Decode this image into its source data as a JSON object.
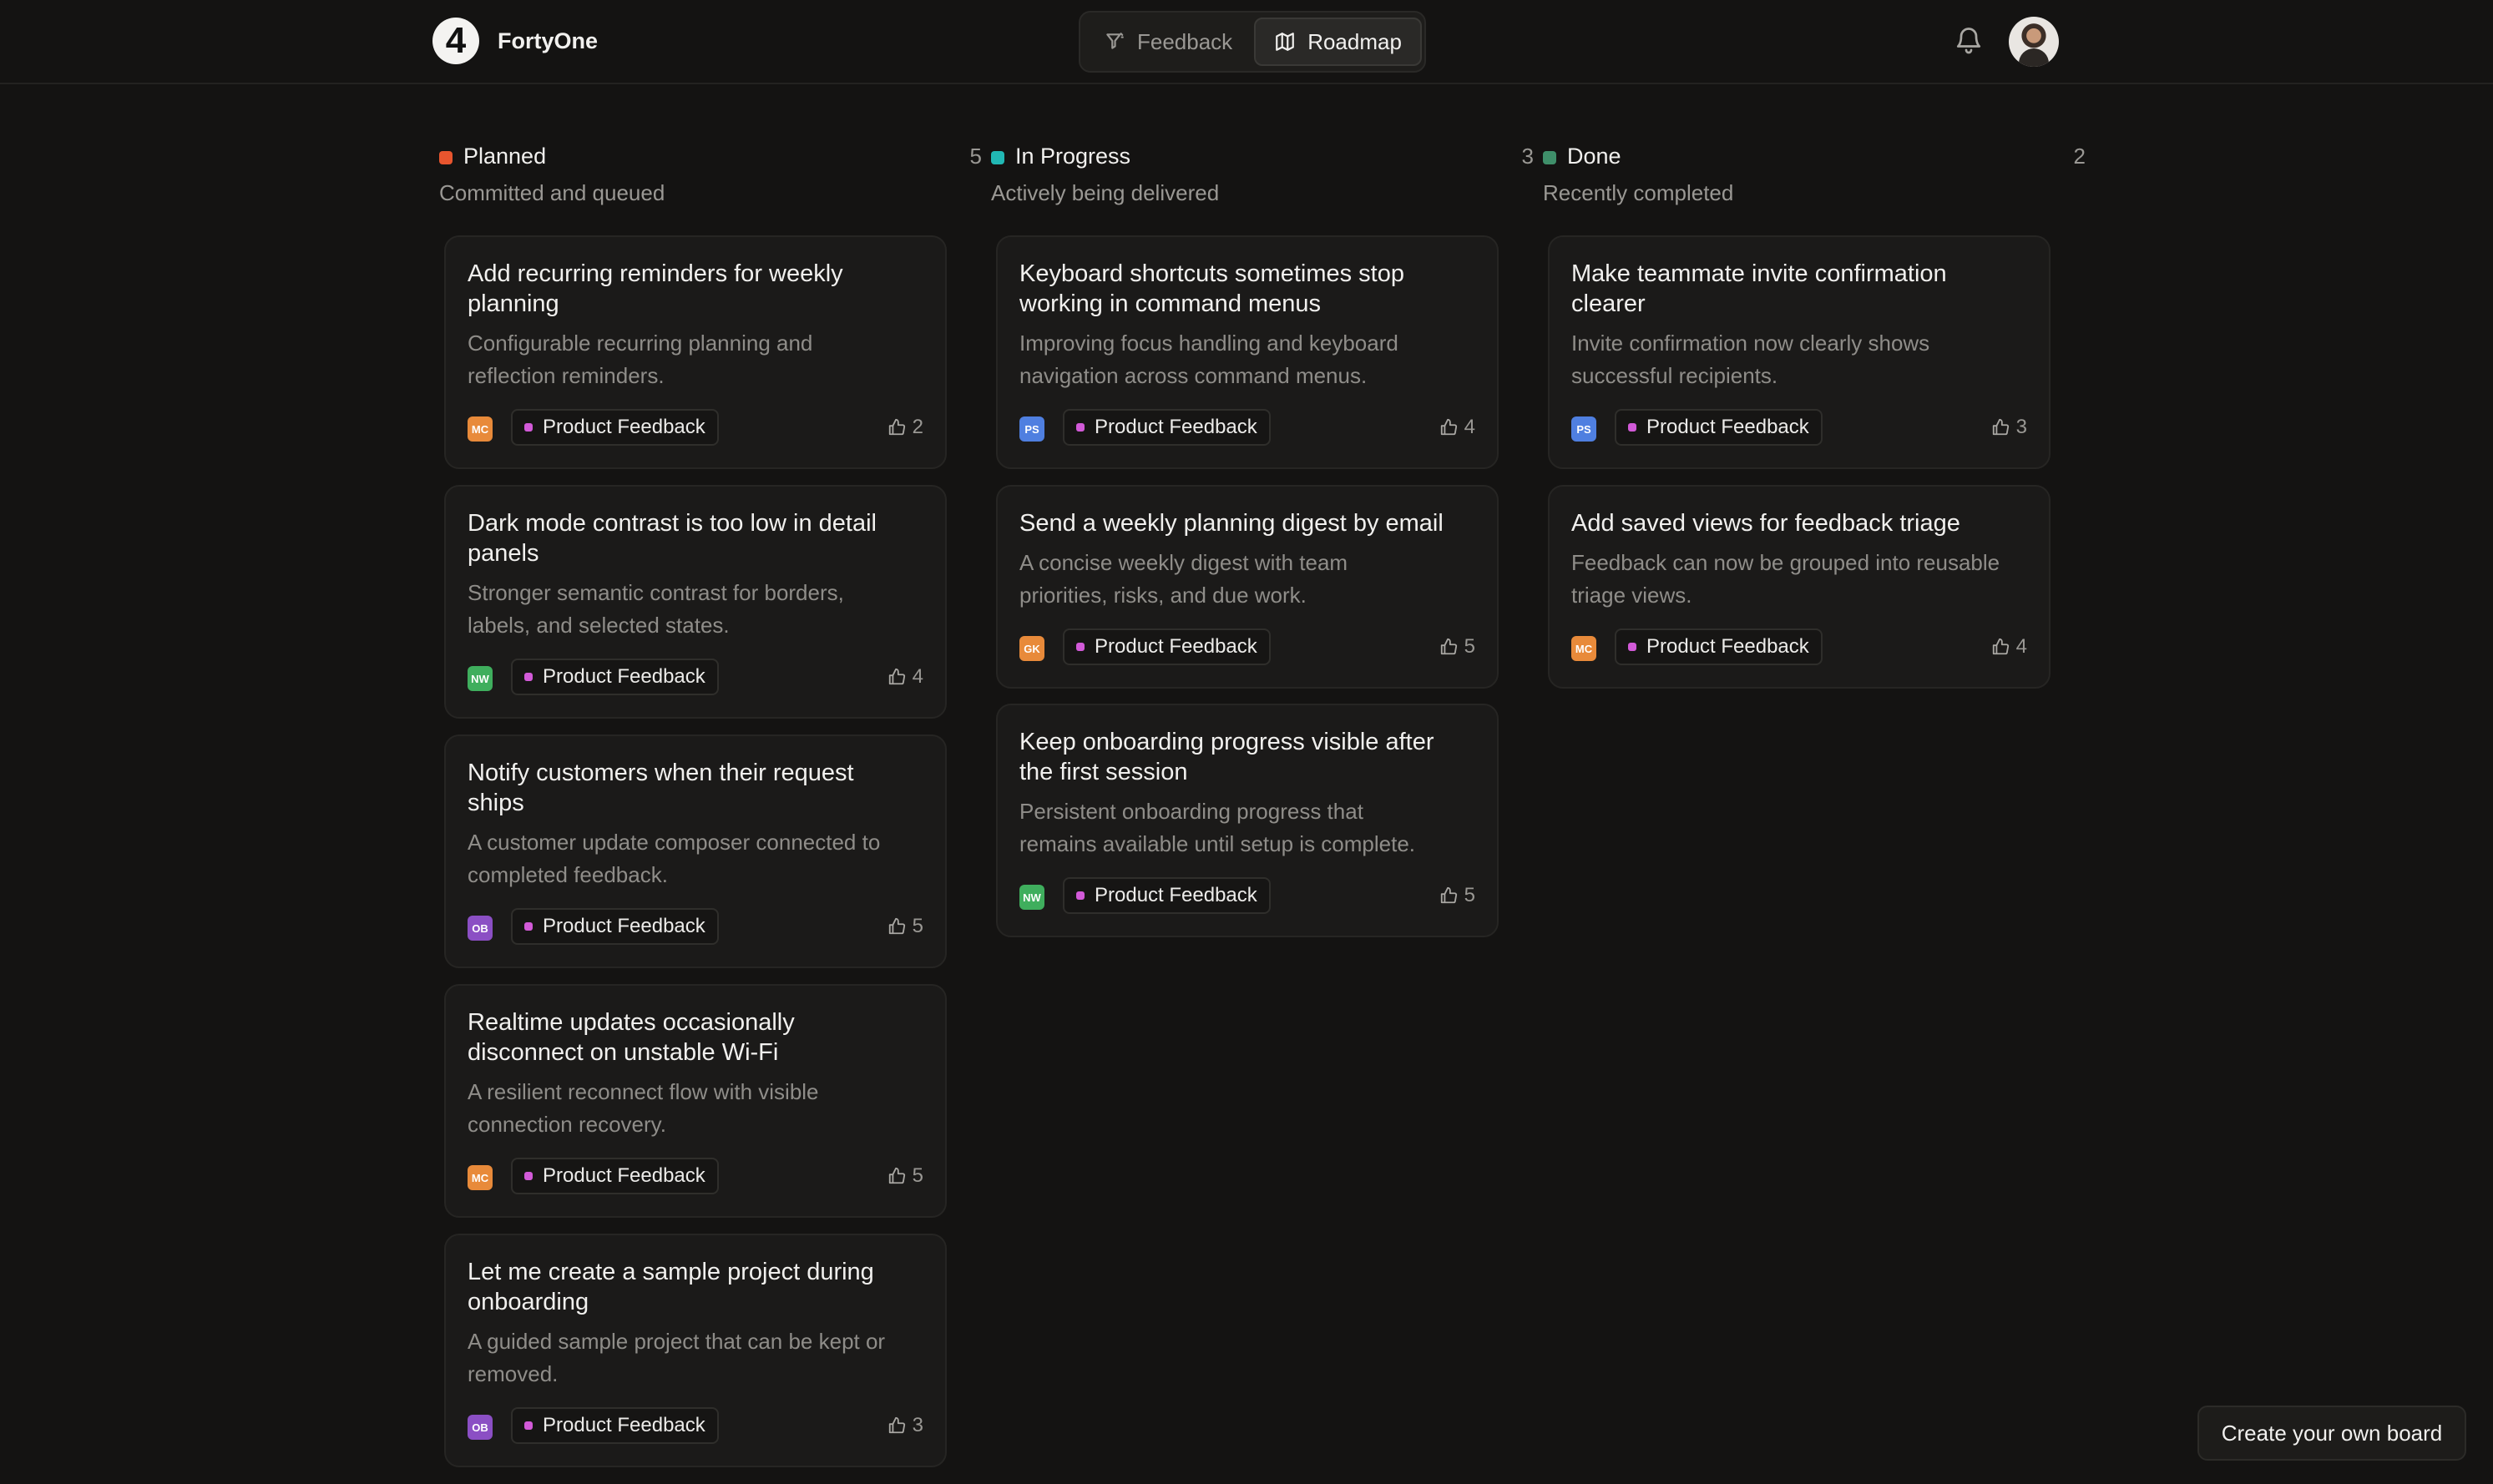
{
  "app": {
    "name": "FortyOne",
    "logo_glyph": "4"
  },
  "nav": {
    "tabs": [
      {
        "label": "Feedback",
        "icon": "funnel-icon",
        "active": false
      },
      {
        "label": "Roadmap",
        "icon": "map-icon",
        "active": true
      }
    ]
  },
  "colors": {
    "planned": "#e8552e",
    "in_progress": "#21b8b4",
    "done": "#3f8f6a",
    "tag_dot": "#d25ad8",
    "MC": "#e88a3a",
    "NW": "#3fae5d",
    "OB": "#8b4fc4",
    "PS": "#4f7fe0",
    "GK": "#e88a3a"
  },
  "columns": [
    {
      "title": "Planned",
      "count": "5",
      "subtitle": "Committed and queued",
      "cards": [
        {
          "title_lines": [
            "Add recurring reminders for weekly",
            "planning"
          ],
          "desc_lines": [
            "Configurable recurring planning and",
            "reflection reminders."
          ],
          "initials": "MC",
          "tag": "Product Feedback",
          "votes": "2"
        },
        {
          "title_lines": [
            "Dark mode contrast is too low in detail",
            "panels"
          ],
          "desc_lines": [
            "Stronger semantic contrast for borders,",
            "labels, and selected states."
          ],
          "initials": "NW",
          "tag": "Product Feedback",
          "votes": "4"
        },
        {
          "title_lines": [
            "Notify customers when their request",
            "ships"
          ],
          "desc_lines": [
            "A customer update composer connected to",
            "completed feedback."
          ],
          "initials": "OB",
          "tag": "Product Feedback",
          "votes": "5"
        },
        {
          "title_lines": [
            "Realtime updates occasionally",
            "disconnect on unstable Wi-Fi"
          ],
          "desc_lines": [
            "A resilient reconnect flow with visible",
            "connection recovery."
          ],
          "initials": "MC",
          "tag": "Product Feedback",
          "votes": "5"
        },
        {
          "title_lines": [
            "Let me create a sample project during",
            "onboarding"
          ],
          "desc_lines": [
            "A guided sample project that can be kept or",
            "removed."
          ],
          "initials": "OB",
          "tag": "Product Feedback",
          "votes": "3"
        }
      ]
    },
    {
      "title": "In Progress",
      "count": "3",
      "subtitle": "Actively being delivered",
      "cards": [
        {
          "title_lines": [
            "Keyboard shortcuts sometimes stop",
            "working in command menus"
          ],
          "desc_lines": [
            "Improving focus handling and keyboard",
            "navigation across command menus."
          ],
          "initials": "PS",
          "tag": "Product Feedback",
          "votes": "4"
        },
        {
          "title_lines": [
            "Send a weekly planning digest by email"
          ],
          "desc_lines": [
            "A concise weekly digest with team",
            "priorities, risks, and due work."
          ],
          "initials": "GK",
          "tag": "Product Feedback",
          "votes": "5"
        },
        {
          "title_lines": [
            "Keep onboarding progress visible after",
            "the first session"
          ],
          "desc_lines": [
            "Persistent onboarding progress that",
            "remains available until setup is complete."
          ],
          "initials": "NW",
          "tag": "Product Feedback",
          "votes": "5"
        }
      ]
    },
    {
      "title": "Done",
      "count": "2",
      "subtitle": "Recently completed",
      "cards": [
        {
          "title_lines": [
            "Make teammate invite confirmation",
            "clearer"
          ],
          "desc_lines": [
            "Invite confirmation now clearly shows",
            "successful recipients."
          ],
          "initials": "PS",
          "tag": "Product Feedback",
          "votes": "3"
        },
        {
          "title_lines": [
            "Add saved views for feedback triage"
          ],
          "desc_lines": [
            "Feedback can now be grouped into reusable",
            "triage views."
          ],
          "initials": "MC",
          "tag": "Product Feedback",
          "votes": "4"
        }
      ]
    }
  ],
  "cta": {
    "label": "Create your own board"
  }
}
